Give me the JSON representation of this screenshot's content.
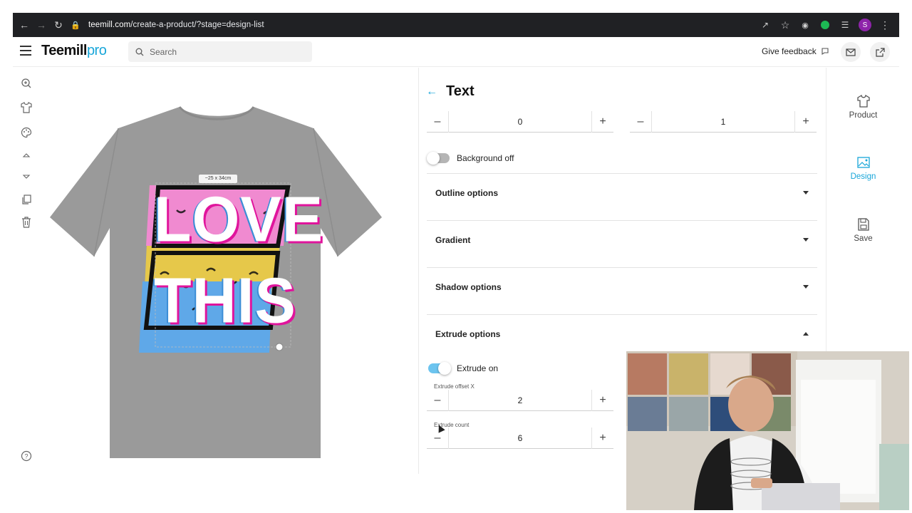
{
  "browser": {
    "url_host": "teemill.com",
    "url_path": "/create-a-product/?stage=design-list",
    "profile_initial": "S"
  },
  "header": {
    "logo_main": "Teemill",
    "logo_suffix": "pro",
    "search_placeholder": "Search",
    "feedback_label": "Give feedback"
  },
  "tshirt": {
    "dimension_label": "~25 x 34cm",
    "line1": "LOVE",
    "line2": "THIS",
    "shirt_color": "#9a9a9a"
  },
  "panel": {
    "title": "Text",
    "steppers_top": [
      {
        "value": "0"
      },
      {
        "value": "1"
      }
    ],
    "background_toggle": {
      "label": "Background off",
      "on": false
    },
    "sections": [
      {
        "title": "Outline options",
        "expanded": false
      },
      {
        "title": "Gradient",
        "expanded": false
      },
      {
        "title": "Shadow options",
        "expanded": false
      },
      {
        "title": "Extrude options",
        "expanded": true
      }
    ],
    "extrude_toggle": {
      "label": "Extrude on",
      "on": true
    },
    "extrude_offset_x": {
      "label": "Extrude offset X",
      "value": "2"
    },
    "extrude_count": {
      "label": "Extrude count",
      "value": "6"
    }
  },
  "rail": {
    "items": [
      {
        "label": "Product",
        "icon": "tshirt-icon",
        "active": false
      },
      {
        "label": "Design",
        "icon": "image-icon",
        "active": true
      },
      {
        "label": "Save",
        "icon": "save-icon",
        "active": false
      }
    ]
  },
  "colors": {
    "accent": "#18a6d9",
    "toggle_on": "#6cc4ef",
    "toggle_off": "#b5b5b5"
  }
}
